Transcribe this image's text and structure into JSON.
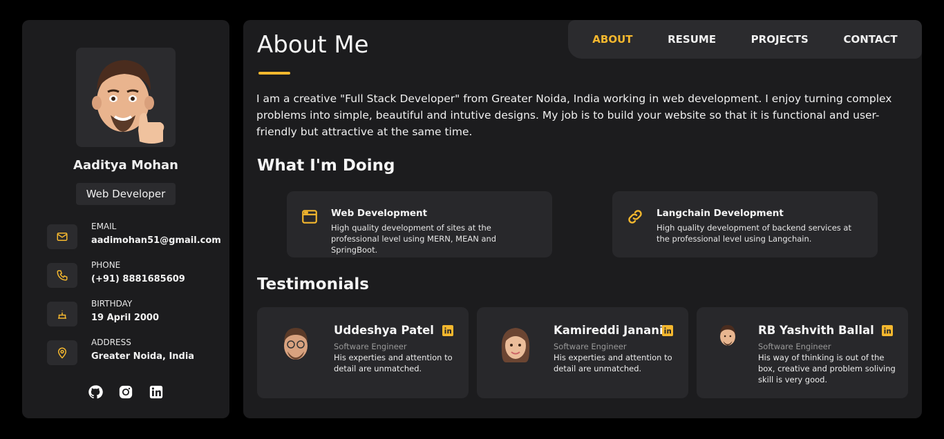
{
  "colors": {
    "accent": "#f5b82e",
    "panel": "#1c1c1e",
    "card": "#28282b"
  },
  "profile": {
    "name": "Aaditya Mohan",
    "role": "Web Developer",
    "contacts": [
      {
        "label": "EMAIL",
        "value": "aadimohan51@gmail.com",
        "icon": "mail-icon"
      },
      {
        "label": "PHONE",
        "value": "(+91) 8881685609",
        "icon": "phone-icon"
      },
      {
        "label": "BIRTHDAY",
        "value": "19 April 2000",
        "icon": "cake-icon"
      },
      {
        "label": "ADDRESS",
        "value": "Greater Noida, India",
        "icon": "location-icon"
      }
    ],
    "socials": [
      "github-icon",
      "instagram-icon",
      "linkedin-icon"
    ]
  },
  "nav": {
    "about": "ABOUT",
    "resume": "RESUME",
    "projects": "PROJECTS",
    "contact": "CONTACT"
  },
  "main": {
    "title": "About Me",
    "intro": "I am a creative \"Full Stack Developer\" from Greater Noida, India working in web development. I enjoy turning complex problems into simple, beautiful and intutive designs. My job is to build your website so that it is functional and user-friendly but attractive at the same time.",
    "doing_title": "What I'm Doing",
    "services": [
      {
        "title": "Web Development",
        "desc": "High quality development of sites at the professional level using MERN, MEAN and SpringBoot.",
        "icon": "browser-icon"
      },
      {
        "title": "Langchain Development",
        "desc": "High quality development of backend services at the professional level using Langchain.",
        "icon": "chain-link-icon"
      }
    ],
    "testimonials_title": "Testimonials",
    "testimonials": [
      {
        "name": "Uddeshya Patel",
        "job": "Software Engineer",
        "text": "His experties and attention to detail are unmatched."
      },
      {
        "name": "Kamireddi Janani",
        "job": "Software Engineer",
        "text": "His experties and attention to detail are unmatched."
      },
      {
        "name": "RB Yashvith Ballal",
        "job": "Software Engineer",
        "text": "His way of thinking is out of the box, creative and problem soliving skill is very good."
      }
    ]
  }
}
